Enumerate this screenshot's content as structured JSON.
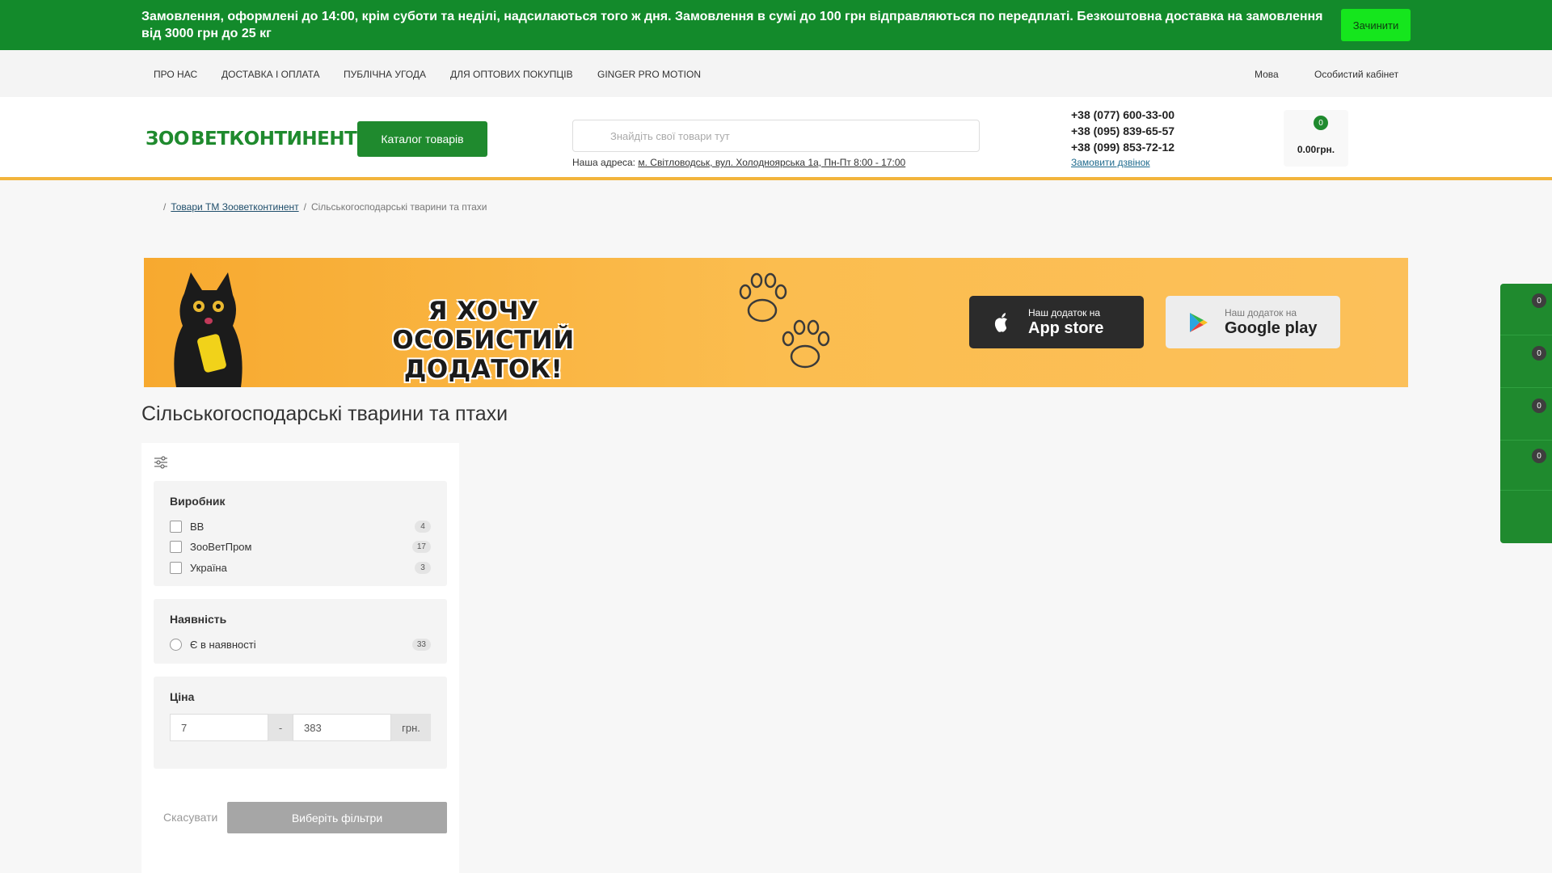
{
  "notice": {
    "text": "Замовлення, оформлені до 14:00, крім суботи та неділі, надсилаються того ж дня. Замовлення в сумі до 100 грн відправляються по передплаті. Безкоштовна доставка на замовлення від 3000 грн до 25 кг",
    "close_label": "Зачинити"
  },
  "topnav": {
    "links": [
      "ПРО НАС",
      "ДОСТАВКА І ОПЛАТА",
      "ПУБЛІЧНА УГОДА",
      "ДЛЯ ОПТОВИХ ПОКУПЦІВ",
      "GINGER PRO MOTION"
    ],
    "language": "Мова",
    "account": "Особистий кабінет"
  },
  "header": {
    "logo_text_left": "ЗОО",
    "logo_text_right": "ВЕТКОНТИНЕНТ",
    "catalog_label": "Каталог товарів",
    "search_placeholder": "Знайдіть свої товари тут",
    "address_label": "Наша адреса:",
    "address_value": "м. Світловодськ, вул. Холодноярська 1а, Пн-Пт 8:00 - 17:00",
    "phones": [
      "+38 (077) 600-33-00",
      "+38 (095) 839-65-57",
      "+38 (099) 853-72-12"
    ],
    "callback_label": "Замовити дзвінок",
    "cart_count": "0",
    "cart_total": "0.00грн."
  },
  "breadcrumb": {
    "link": "Товари ТМ Зооветконтинент",
    "current": "Сільськогосподарські тварини та птахи"
  },
  "banner": {
    "title": "Я ХОЧУ ОСОБИСТИЙ ДОДАТОК!",
    "app_store_small": "Наш додаток на",
    "app_store_big": "App store",
    "google_play_small": "Наш додаток на",
    "google_play_big": "Google play"
  },
  "page_title": "Сільськогосподарські тварини та птахи",
  "filters": {
    "manufacturer": {
      "title": "Виробник",
      "options": [
        {
          "label": "ВВ",
          "count": "4"
        },
        {
          "label": "ЗооВетПром",
          "count": "17"
        },
        {
          "label": "Україна",
          "count": "3"
        }
      ]
    },
    "availability": {
      "title": "Наявність",
      "options": [
        {
          "label": "Є в наявності",
          "count": "33"
        }
      ]
    },
    "price": {
      "title": "Ціна",
      "min": "7",
      "max": "383",
      "dash": "-",
      "unit": "грн."
    },
    "cancel_label": "Скасувати",
    "apply_label": "Виберіть фільтри"
  },
  "side_panel": {
    "badges": [
      "0",
      "0",
      "0",
      "0"
    ]
  },
  "colors": {
    "brand_green": "#1f8a2e",
    "notice_green": "#138a2b",
    "accent_orange": "#f2b43c"
  }
}
